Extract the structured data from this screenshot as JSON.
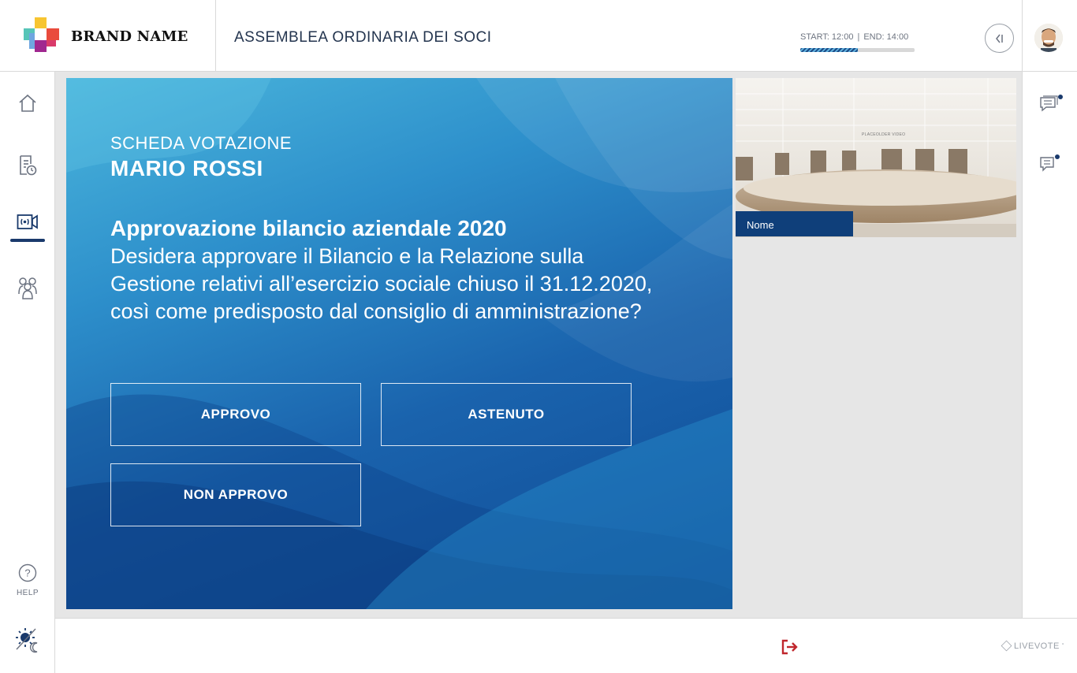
{
  "header": {
    "brand": "BRAND NAME",
    "assembly_title": "ASSEMBLEA ORDINARIA DEI SOCI",
    "start_label": "START: 12:00",
    "end_label": "END: 14:00",
    "progress_fraction": 0.5
  },
  "sidebar": {
    "items": [
      {
        "icon": "home-icon"
      },
      {
        "icon": "document-clock-icon"
      },
      {
        "icon": "broadcast-video-icon",
        "active": true
      },
      {
        "icon": "users-icon"
      }
    ],
    "help_label": "HELP"
  },
  "vote_card": {
    "eyebrow": "SCHEDA VOTAZIONE",
    "voter_name": "MARIO ROSSI",
    "question_title": "Approvazione bilancio aziendale 2020",
    "question_text": "Desidera approvare il Bilancio e la Relazione sulla Gestione relativi all’esercizio sociale chiuso il 31.12.2020, così come predisposto dal consiglio di amministrazione?",
    "buttons": {
      "approve": "APPROVO",
      "abstain": "ASTENUTO",
      "reject": "NON APPROVO"
    }
  },
  "video": {
    "name_label": "Nome",
    "placeholder": "PLACEOLDER VIDEO"
  },
  "footer": {
    "vendor": "LIVEVOTE",
    "vendor_mark": "°"
  },
  "colors": {
    "accent": "#1a3a6c",
    "logout": "#c0272d"
  }
}
